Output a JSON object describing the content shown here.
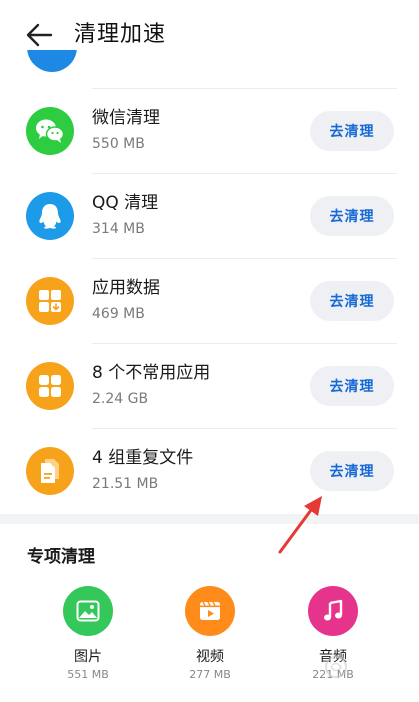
{
  "header": {
    "title": "清理加速"
  },
  "items": [
    {
      "title": "微信清理",
      "size": "550 MB",
      "button": "去清理",
      "icon": "wechat-icon",
      "color": "#2ecc40"
    },
    {
      "title": "QQ 清理",
      "size": "314 MB",
      "button": "去清理",
      "icon": "qq-penguin-icon",
      "color": "#1e9be8"
    },
    {
      "title": "应用数据",
      "size": "469 MB",
      "button": "去清理",
      "icon": "app-data-icon",
      "color": "#f7a21b"
    },
    {
      "title": "8 个不常用应用",
      "size": "2.24 GB",
      "button": "去清理",
      "icon": "apps-grid-icon",
      "color": "#f7a21b"
    },
    {
      "title": "4 组重复文件",
      "size": "21.51 MB",
      "button": "去清理",
      "icon": "duplicate-files-icon",
      "color": "#f7a21b"
    }
  ],
  "special": {
    "title": "专项清理",
    "items": [
      {
        "label": "图片",
        "size": "551 MB",
        "icon": "image-icon",
        "color": "#34c759"
      },
      {
        "label": "视频",
        "size": "277 MB",
        "icon": "video-icon",
        "color": "#ff8c1a"
      },
      {
        "label": "音频",
        "size": "221 MB",
        "icon": "music-icon",
        "color": "#e6348d"
      }
    ]
  },
  "colors": {
    "accent": "#1769d6",
    "annotation": "#e53935"
  }
}
